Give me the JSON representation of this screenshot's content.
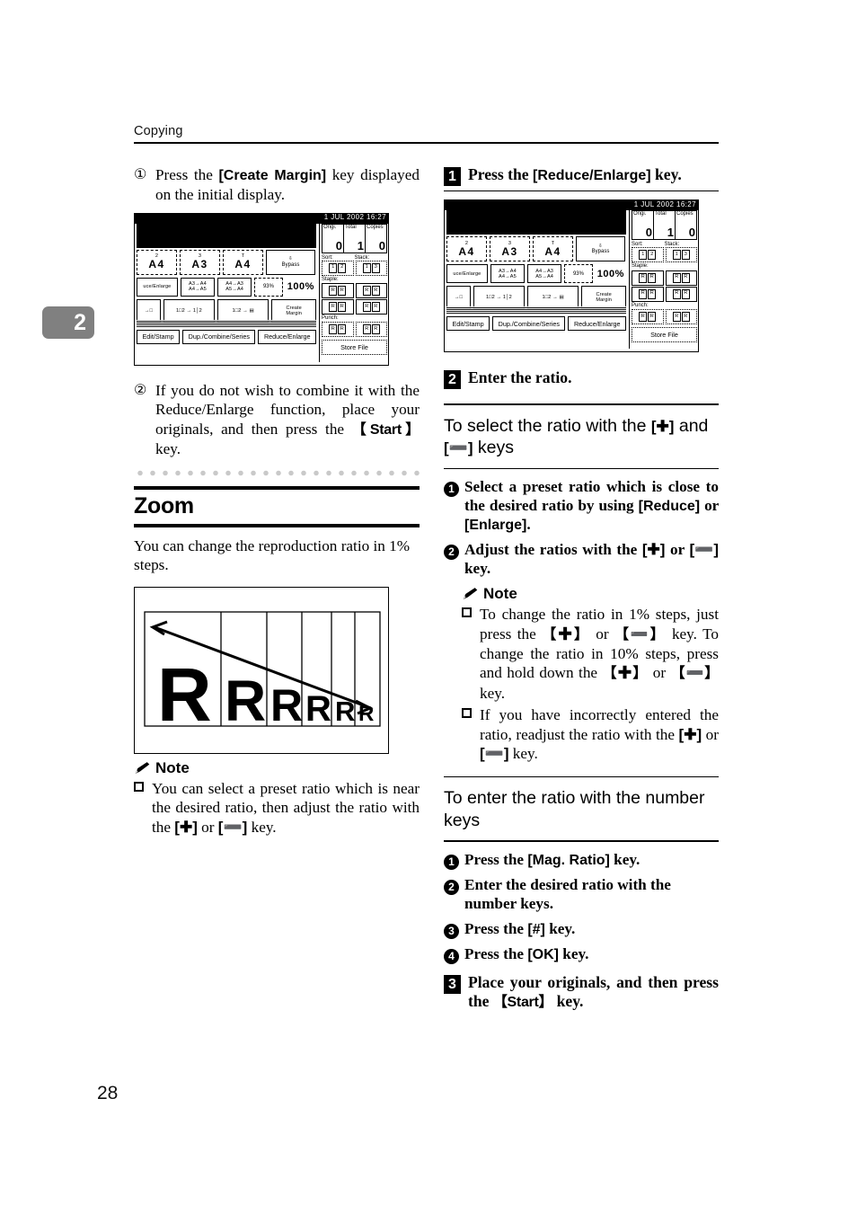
{
  "page": {
    "running_head": "Copying",
    "chapter_tab": "2",
    "page_number": "28"
  },
  "left_column": {
    "step1": {
      "marker": "①",
      "text_parts": [
        "Press the ",
        "[Create Margin]",
        " key displayed on the initial display."
      ]
    },
    "step2": {
      "marker": "②",
      "text_parts": [
        "If you do not wish to combine it with the Reduce/Enlarge function, place your originals, and then press the ",
        "【Start】",
        " key."
      ]
    },
    "section": {
      "title": "Zoom",
      "intro": "You can change the reproduction ratio in 1% steps."
    },
    "note": {
      "label": "Note",
      "bullet_parts": [
        "You can select a preset ratio which is near the desired ratio, then adjust the ratio with the ",
        "[✚]",
        " or ",
        "[➖]",
        " key."
      ]
    },
    "figure": {
      "name": "zoom-ratio-illustration",
      "letters": [
        "R",
        "R",
        "R",
        "R",
        "R",
        "R"
      ],
      "arrow": "diagonal-arrow-large-to-small"
    }
  },
  "right_column": {
    "step1": {
      "badge": "1",
      "text_parts": [
        "Press the ",
        "[Reduce/Enlarge]",
        " key."
      ]
    },
    "step2": {
      "badge": "2",
      "text": "Enter the ratio."
    },
    "subhead1": {
      "parts": [
        "To select the ratio with the ",
        "[✚]",
        " and ",
        "[➖]",
        " keys"
      ]
    },
    "substeps1": [
      {
        "num": "1",
        "parts": [
          "Select a preset ratio which is close to the desired ratio by using ",
          "[Reduce]",
          " or ",
          "[Enlarge]",
          "."
        ]
      },
      {
        "num": "2",
        "parts": [
          "Adjust the ratios with the ",
          "[✚]",
          " or ",
          "[➖]",
          " key."
        ]
      }
    ],
    "note": {
      "label": "Note",
      "bullets": [
        {
          "parts": [
            "To change the ratio in 1% steps, just press the ",
            "【✚】",
            " or ",
            "【➖】",
            " key. To change the ratio in 10% steps, press and hold down the ",
            "【✚】",
            " or ",
            "【➖】",
            " key."
          ]
        },
        {
          "parts": [
            "If you have incorrectly entered the ratio, readjust the ratio with the ",
            "[✚]",
            " or ",
            "[➖]",
            " key."
          ]
        }
      ]
    },
    "subhead2": {
      "text": "To enter the ratio with the number keys"
    },
    "substeps2": [
      {
        "num": "1",
        "parts": [
          "Press the ",
          "[Mag. Ratio]",
          " key."
        ]
      },
      {
        "num": "2",
        "parts": [
          "Enter the desired ratio with the number keys."
        ]
      },
      {
        "num": "3",
        "parts": [
          "Press the ",
          "[#]",
          " key."
        ]
      },
      {
        "num": "4",
        "parts": [
          "Press the ",
          "[OK]",
          " key."
        ]
      }
    ],
    "step3": {
      "badge": "3",
      "text_parts": [
        "Place your originals, and then press the ",
        "【Start】",
        " key."
      ]
    }
  },
  "lcd_panel": {
    "datetime": "1 JUL  2002 16:27",
    "counters": [
      {
        "label": "Origi.",
        "value": "0"
      },
      {
        "label": "Total",
        "value": "1"
      },
      {
        "label": "Copies",
        "value": "0"
      }
    ],
    "paper_keys": [
      {
        "top": "2",
        "size": "A4"
      },
      {
        "top": "3",
        "size": "A3"
      },
      {
        "top": "T",
        "size": "A4"
      }
    ],
    "bypass_label": "Bypass",
    "ratio_row": {
      "reduce_enlarge_label": "uce/Enlarge",
      "preset1": [
        "A3→A4",
        "A4→A5"
      ],
      "preset2": [
        "A4→A3",
        "A5→A4"
      ],
      "preset3": "93%",
      "current": "100%"
    },
    "create_margin_label": [
      "Create",
      "Margin"
    ],
    "bottom_tabs": [
      "Edit/Stamp",
      "Dup./Combine/Series",
      "Reduce/Enlarge"
    ],
    "store_file_label": "Store File",
    "finisher": {
      "sort_label": "Sort:",
      "stack_label": "Stack:",
      "staple_label": "Staple:",
      "punch_label": "Punch:"
    }
  }
}
